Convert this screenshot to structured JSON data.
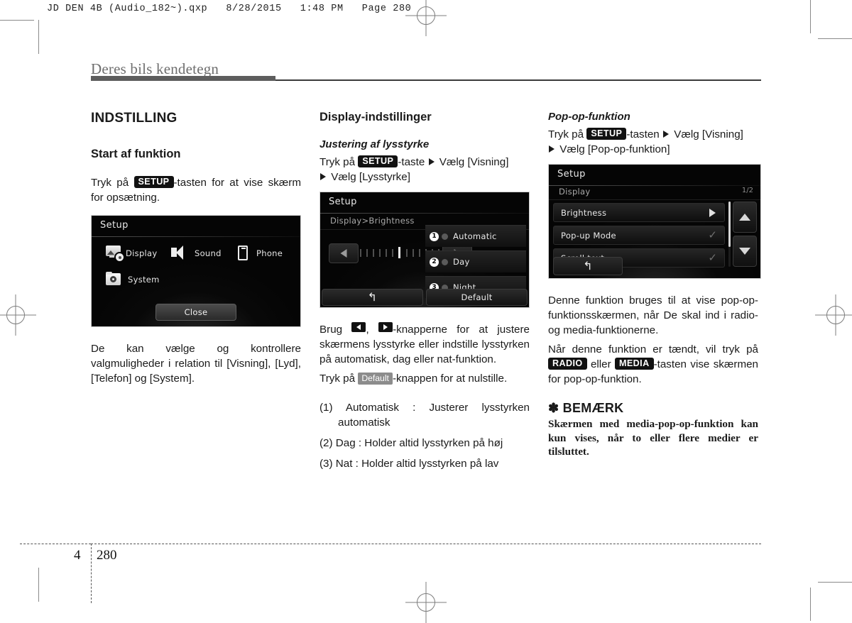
{
  "slug": "JD DEN 4B (Audio_182~).qxp   8/28/2015   1:48 PM   Page 280",
  "running_head": "Deres bils kendetegn",
  "footer": {
    "chapter": "4",
    "page": "280"
  },
  "col1": {
    "section_title": "INDSTILLING",
    "subheading": "Start af funktion",
    "intro_pre": "Tryk på",
    "intro_key": "SETUP",
    "intro_post": "-tasten for at vise skærm for opsætning.",
    "after_text": "De kan vælge og kontrollere valgmuligheder i relation til [Visning], [Lyd], [Telefon] og [System].",
    "screenshot": {
      "title": "Setup",
      "items": [
        {
          "label": "Display",
          "icon": "display-settings-icon"
        },
        {
          "label": "Sound",
          "icon": "speaker-icon"
        },
        {
          "label": "Phone",
          "icon": "phone-icon"
        },
        {
          "label": "System",
          "icon": "system-folder-icon"
        }
      ],
      "close_label": "Close"
    }
  },
  "col2": {
    "heading": "Display-indstillinger",
    "sub_italic": "Justering af lysstyrke",
    "path_pre": "Tryk på",
    "path_key": "SETUP",
    "path_mid": "-taste",
    "path_1": "Vælg [Visning]",
    "path_2": "Vælg [Lysstyrke]",
    "screenshot": {
      "title": "Setup",
      "breadcrumb": "Display>Brightness",
      "options": [
        {
          "num": "1",
          "label": "Automatic"
        },
        {
          "num": "2",
          "label": "Day"
        },
        {
          "num": "3",
          "label": "Night"
        }
      ],
      "back_glyph": "↰",
      "default_label": "Default",
      "tick_count": 13,
      "active_tick_index": 6
    },
    "body_pre": "Brug",
    "body_mid": ",",
    "body_post": "-knapperne for at justere skærmens lysstyrke eller indstille lysstyrken på automatisk, dag eller nat-funktion.",
    "reset_pre": "Tryk på",
    "reset_key": "Default",
    "reset_post": "-knappen for at nulstille.",
    "numbered": [
      "(1) Automatisk : Justerer lysstyrken automatisk",
      "(2) Dag : Holder altid lysstyrken på høj",
      "(3) Nat : Holder altid lysstyrken på lav"
    ]
  },
  "col3": {
    "sub_italic": "Pop-op-funktion",
    "path_pre": "Tryk på",
    "path_key": "SETUP",
    "path_mid": "-tasten",
    "path_1": "Vælg [Visning]",
    "path_2": "Vælg [Pop-op-funktion]",
    "screenshot": {
      "title": "Setup",
      "breadcrumb": "Display",
      "page_indicator": "1/2",
      "items": [
        {
          "label": "Brightness",
          "control": "arrow"
        },
        {
          "label": "Pop-up Mode",
          "control": "check"
        },
        {
          "label": "Scroll text",
          "control": "check"
        }
      ],
      "back_glyph": "↰"
    },
    "body1": "Denne funktion bruges til at vise pop-op-funktionsskærmen, når De skal ind i radio- og media-funktionerne.",
    "body2_pre": "Når denne funktion er tændt, vil tryk på",
    "body2_key1": "RADIO",
    "body2_mid": "eller",
    "body2_key2": "MEDIA",
    "body2_post": "-tasten vise skærmen for pop-op-funktion.",
    "note_title": "✽ BEMÆRK",
    "note_body": "Skærmen med media-pop-op-funktion kan kun vises, når to eller flere medier er tilsluttet."
  }
}
